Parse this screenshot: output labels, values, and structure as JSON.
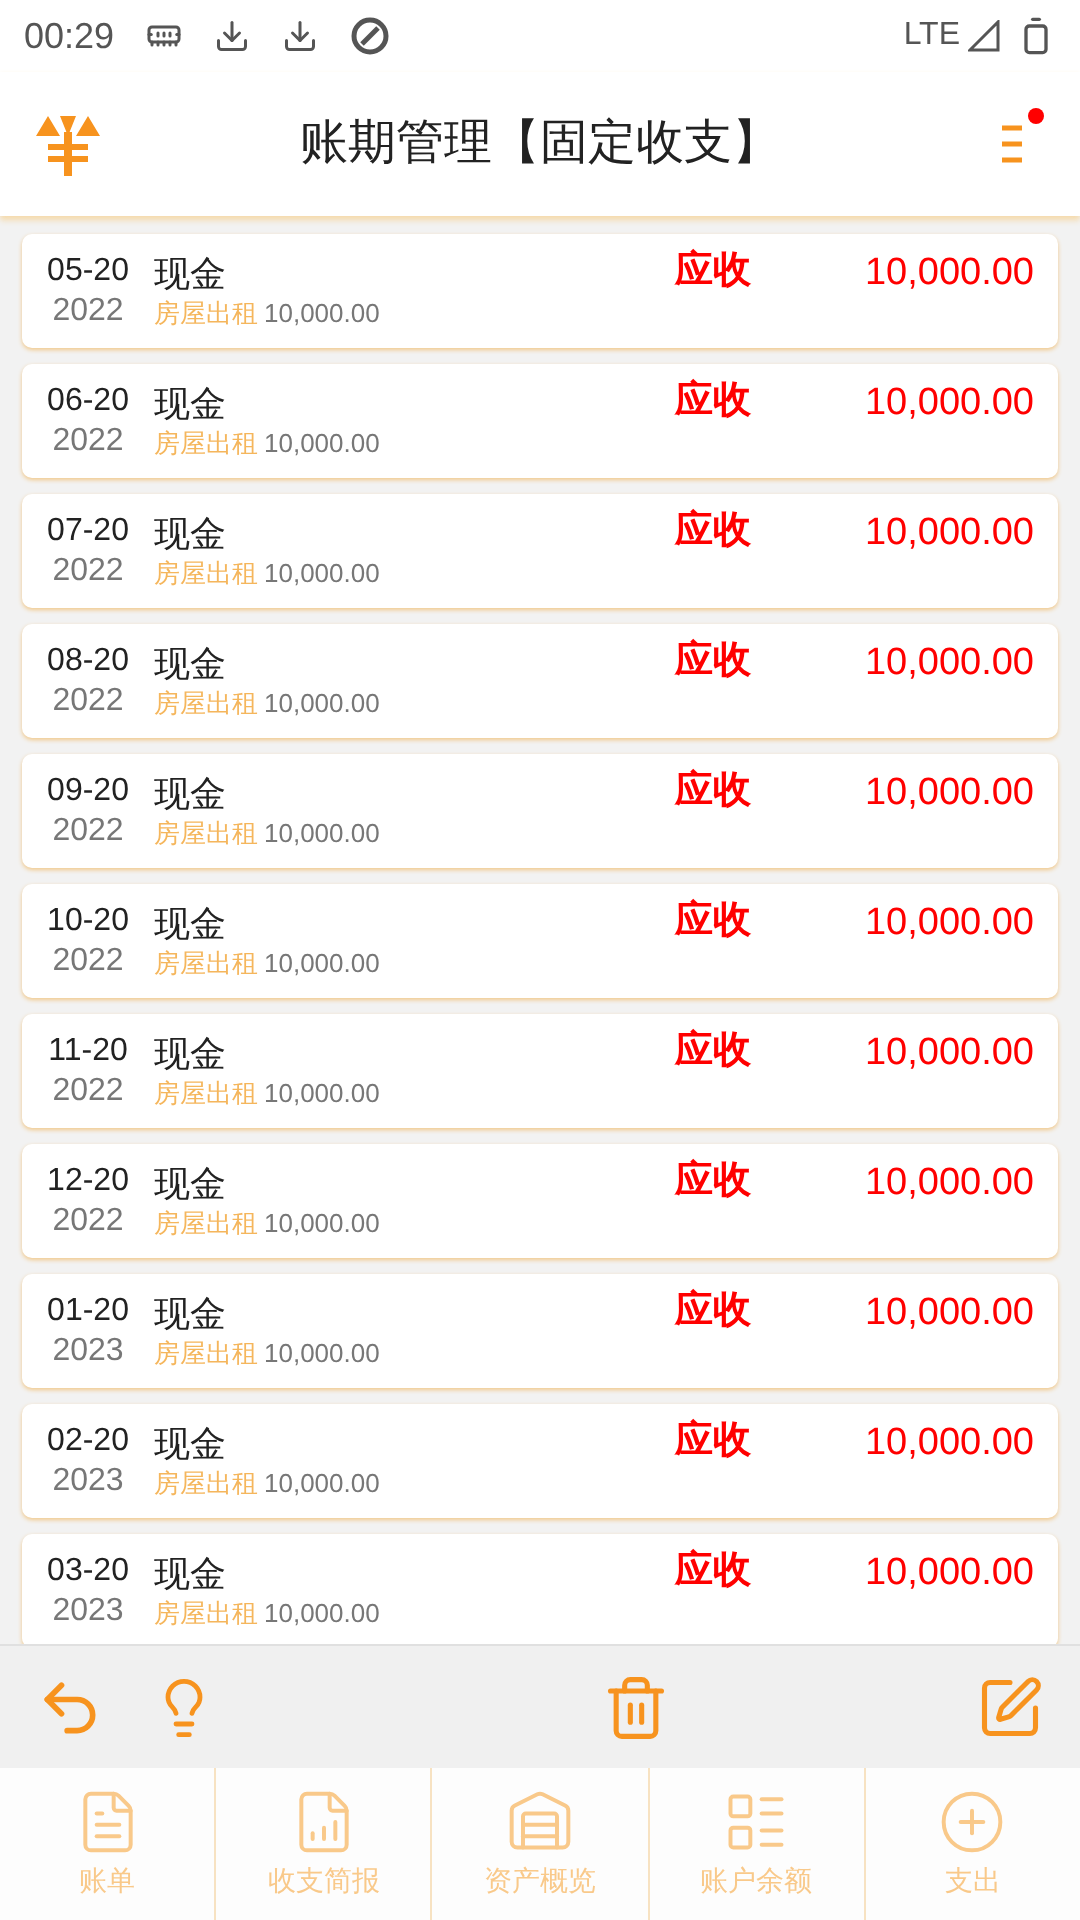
{
  "status_bar": {
    "time": "00:29",
    "network": "LTE"
  },
  "header": {
    "title": "账期管理【固定收支】",
    "menu_badge": true
  },
  "rows": [
    {
      "date": "05-20",
      "year": "2022",
      "account": "现金",
      "type": "应收",
      "amount": "10,000.00",
      "category": "房屋出租",
      "sub_amount": "10,000.00"
    },
    {
      "date": "06-20",
      "year": "2022",
      "account": "现金",
      "type": "应收",
      "amount": "10,000.00",
      "category": "房屋出租",
      "sub_amount": "10,000.00"
    },
    {
      "date": "07-20",
      "year": "2022",
      "account": "现金",
      "type": "应收",
      "amount": "10,000.00",
      "category": "房屋出租",
      "sub_amount": "10,000.00"
    },
    {
      "date": "08-20",
      "year": "2022",
      "account": "现金",
      "type": "应收",
      "amount": "10,000.00",
      "category": "房屋出租",
      "sub_amount": "10,000.00"
    },
    {
      "date": "09-20",
      "year": "2022",
      "account": "现金",
      "type": "应收",
      "amount": "10,000.00",
      "category": "房屋出租",
      "sub_amount": "10,000.00"
    },
    {
      "date": "10-20",
      "year": "2022",
      "account": "现金",
      "type": "应收",
      "amount": "10,000.00",
      "category": "房屋出租",
      "sub_amount": "10,000.00"
    },
    {
      "date": "11-20",
      "year": "2022",
      "account": "现金",
      "type": "应收",
      "amount": "10,000.00",
      "category": "房屋出租",
      "sub_amount": "10,000.00"
    },
    {
      "date": "12-20",
      "year": "2022",
      "account": "现金",
      "type": "应收",
      "amount": "10,000.00",
      "category": "房屋出租",
      "sub_amount": "10,000.00"
    },
    {
      "date": "01-20",
      "year": "2023",
      "account": "现金",
      "type": "应收",
      "amount": "10,000.00",
      "category": "房屋出租",
      "sub_amount": "10,000.00"
    },
    {
      "date": "02-20",
      "year": "2023",
      "account": "现金",
      "type": "应收",
      "amount": "10,000.00",
      "category": "房屋出租",
      "sub_amount": "10,000.00"
    },
    {
      "date": "03-20",
      "year": "2023",
      "account": "现金",
      "type": "应收",
      "amount": "10,000.00",
      "category": "房屋出租",
      "sub_amount": "10,000.00"
    }
  ],
  "nav": [
    {
      "label": "账单",
      "kind": "bill"
    },
    {
      "label": "收支简报",
      "kind": "report"
    },
    {
      "label": "资产概览",
      "kind": "assets"
    },
    {
      "label": "账户余额",
      "kind": "balance"
    },
    {
      "label": "支出",
      "kind": "expense"
    }
  ]
}
